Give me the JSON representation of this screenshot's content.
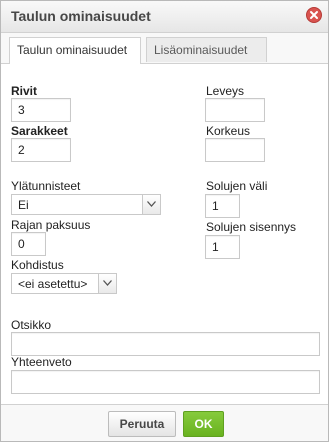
{
  "dialog": {
    "title": "Taulun ominaisuudet"
  },
  "tabs": [
    {
      "label": "Taulun ominaisuudet",
      "active": true
    },
    {
      "label": "Lisäominaisuudet",
      "active": false
    }
  ],
  "form": {
    "rows": {
      "label": "Rivit",
      "value": "3"
    },
    "columns": {
      "label": "Sarakkeet",
      "value": "2"
    },
    "width": {
      "label": "Leveys",
      "value": ""
    },
    "height": {
      "label": "Korkeus",
      "value": ""
    },
    "headers": {
      "label": "Ylätunnisteet",
      "selected": "Ei"
    },
    "cell_spacing": {
      "label": "Solujen väli",
      "value": "1"
    },
    "border_size": {
      "label": "Rajan paksuus",
      "value": "0"
    },
    "cell_padding": {
      "label": "Solujen sisennys",
      "value": "1"
    },
    "alignment": {
      "label": "Kohdistus",
      "selected": "<ei asetettu>"
    },
    "caption": {
      "label": "Otsikko",
      "value": ""
    },
    "summary": {
      "label": "Yhteenveto",
      "value": ""
    }
  },
  "footer": {
    "cancel_label": "Peruuta",
    "ok_label": "OK"
  },
  "colors": {
    "ok_button": "#6ab523",
    "close_icon": "#d9534f",
    "border": "#c9c9c9"
  },
  "icons": {
    "close": "close-circle-icon",
    "dropdown": "chevron-down-icon"
  }
}
